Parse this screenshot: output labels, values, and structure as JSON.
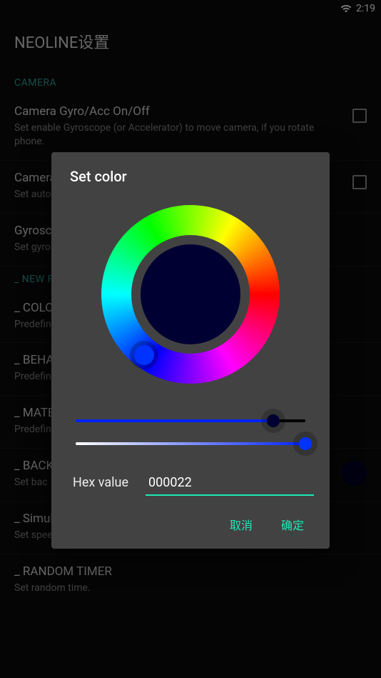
{
  "statusbar": {
    "time": "2:19"
  },
  "page_title": "NEOLINE设置",
  "sections": {
    "camera_header": "CAMERA",
    "new_header": "_ NEW F"
  },
  "settings": {
    "gyro": {
      "title": "Camera Gyro/Acc On/Off",
      "sub": "Set enable Gyroscope (or Accelerator) to move camera, if you rotate phone."
    },
    "camera2": {
      "title": "Camera",
      "sub": "Set auto"
    },
    "gyrosc": {
      "title": "Gyrosc",
      "sub": "Set gyro"
    },
    "color": {
      "title": "_ COLO",
      "sub": "Predefin"
    },
    "beha": {
      "title": "_ BEHA",
      "sub": "Predefin"
    },
    "mate": {
      "title": "_ MATE",
      "sub": "Predefin"
    },
    "back": {
      "title": "_ BACK",
      "sub": "Set bac"
    },
    "simspeed": {
      "title": "_ Simulation speed",
      "sub": "Set speed of simulation."
    },
    "randtimer": {
      "title": "_ RANDOM TIMER",
      "sub": "Set random time."
    }
  },
  "dialog": {
    "title": "Set color",
    "hex_label": "Hex value",
    "hex_value": "000022",
    "cancel": "取消",
    "confirm": "确定",
    "preview_color": "#000033",
    "slider1_value": 0.86,
    "slider2_value": 1.0
  }
}
